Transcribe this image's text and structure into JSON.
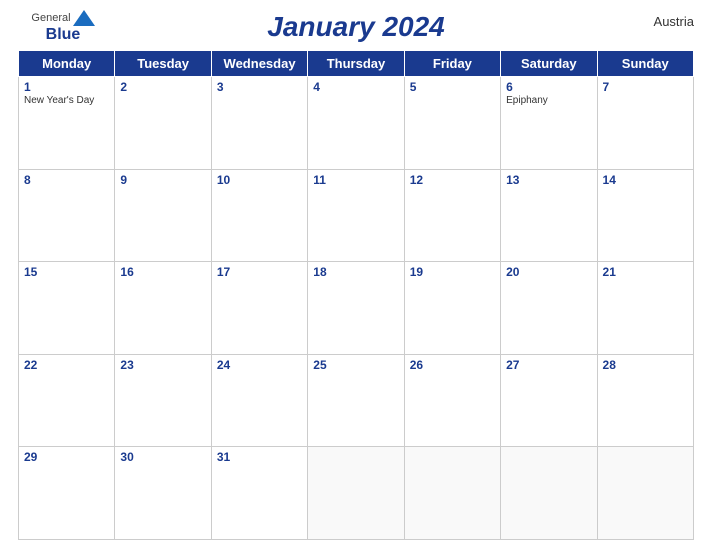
{
  "header": {
    "logo": {
      "general": "General",
      "blue": "Blue",
      "bird_unicode": "▲"
    },
    "title": "January 2024",
    "country": "Austria"
  },
  "days_of_week": [
    "Monday",
    "Tuesday",
    "Wednesday",
    "Thursday",
    "Friday",
    "Saturday",
    "Sunday"
  ],
  "weeks": [
    [
      {
        "day": 1,
        "holiday": "New Year's Day"
      },
      {
        "day": 2,
        "holiday": ""
      },
      {
        "day": 3,
        "holiday": ""
      },
      {
        "day": 4,
        "holiday": ""
      },
      {
        "day": 5,
        "holiday": ""
      },
      {
        "day": 6,
        "holiday": "Epiphany"
      },
      {
        "day": 7,
        "holiday": ""
      }
    ],
    [
      {
        "day": 8,
        "holiday": ""
      },
      {
        "day": 9,
        "holiday": ""
      },
      {
        "day": 10,
        "holiday": ""
      },
      {
        "day": 11,
        "holiday": ""
      },
      {
        "day": 12,
        "holiday": ""
      },
      {
        "day": 13,
        "holiday": ""
      },
      {
        "day": 14,
        "holiday": ""
      }
    ],
    [
      {
        "day": 15,
        "holiday": ""
      },
      {
        "day": 16,
        "holiday": ""
      },
      {
        "day": 17,
        "holiday": ""
      },
      {
        "day": 18,
        "holiday": ""
      },
      {
        "day": 19,
        "holiday": ""
      },
      {
        "day": 20,
        "holiday": ""
      },
      {
        "day": 21,
        "holiday": ""
      }
    ],
    [
      {
        "day": 22,
        "holiday": ""
      },
      {
        "day": 23,
        "holiday": ""
      },
      {
        "day": 24,
        "holiday": ""
      },
      {
        "day": 25,
        "holiday": ""
      },
      {
        "day": 26,
        "holiday": ""
      },
      {
        "day": 27,
        "holiday": ""
      },
      {
        "day": 28,
        "holiday": ""
      }
    ],
    [
      {
        "day": 29,
        "holiday": ""
      },
      {
        "day": 30,
        "holiday": ""
      },
      {
        "day": 31,
        "holiday": ""
      },
      {
        "day": null,
        "holiday": ""
      },
      {
        "day": null,
        "holiday": ""
      },
      {
        "day": null,
        "holiday": ""
      },
      {
        "day": null,
        "holiday": ""
      }
    ]
  ]
}
